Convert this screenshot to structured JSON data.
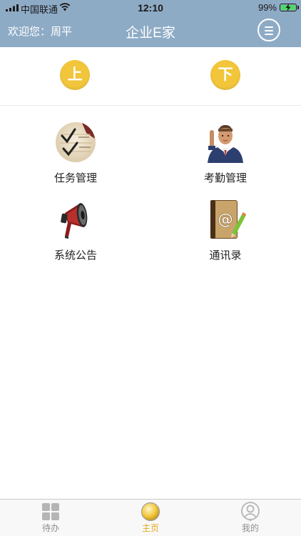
{
  "status_bar": {
    "carrier": "中国联通",
    "time": "12:10",
    "battery": "99%"
  },
  "header": {
    "welcome": "欢迎您：周平",
    "title": "企业E家",
    "menu_icon": "hamburger-menu-icon"
  },
  "nav_arrows": {
    "up_label": "上",
    "down_label": "下"
  },
  "grid": {
    "items": [
      {
        "label": "任务管理",
        "icon": "task-checklist-icon"
      },
      {
        "label": "考勤管理",
        "icon": "attendance-person-icon"
      },
      {
        "label": "系统公告",
        "icon": "megaphone-icon"
      },
      {
        "label": "通讯录",
        "icon": "address-book-icon"
      }
    ]
  },
  "tabbar": {
    "tabs": [
      {
        "label": "待办",
        "icon": "grid-squares-icon",
        "active": false
      },
      {
        "label": "主页",
        "icon": "home-circle-icon",
        "active": true
      },
      {
        "label": "我的",
        "icon": "user-profile-icon",
        "active": false
      }
    ],
    "active_color": "#e3a81a",
    "inactive_color": "#8e8e8e"
  },
  "colors": {
    "header_bg": "#8eabc6",
    "arrow_button": "#f2c53b"
  }
}
